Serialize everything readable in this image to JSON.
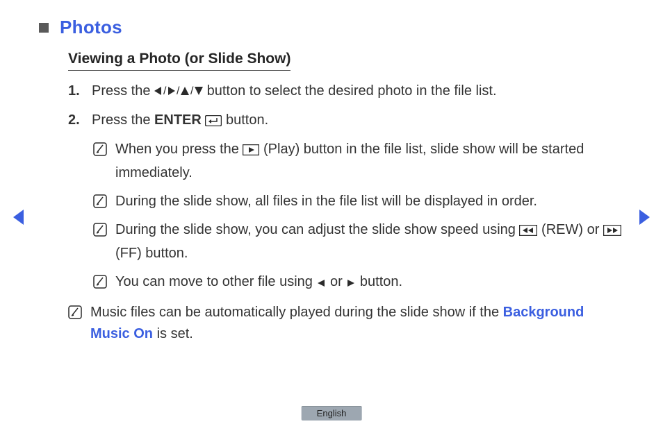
{
  "header": {
    "section_title": "Photos",
    "subtitle": "Viewing a Photo (or Slide Show)"
  },
  "steps": [
    {
      "num": "1.",
      "pre": "Press the ",
      "post": " button to select the desired photo in the file list."
    },
    {
      "num": "2.",
      "pre": "Press the ",
      "enter": "ENTER",
      "post": " button."
    }
  ],
  "notes": [
    {
      "pre": "When you press the ",
      "mid": " (Play) button in the file list, slide show will be started immediately."
    },
    {
      "text": "During the slide show, all files in the file list will be displayed in order."
    },
    {
      "pre": "During the slide show, you can adjust the slide show speed using ",
      "rew": " (REW) or ",
      "ff": " (FF) button."
    },
    {
      "pre": "You can move to other file using ",
      "or": " or ",
      "post": " button."
    }
  ],
  "outer_note": {
    "pre": "Music files can be automatically played during the slide show if the ",
    "link": "Background Music On",
    "post": " is set."
  },
  "footer": {
    "language": "English"
  }
}
